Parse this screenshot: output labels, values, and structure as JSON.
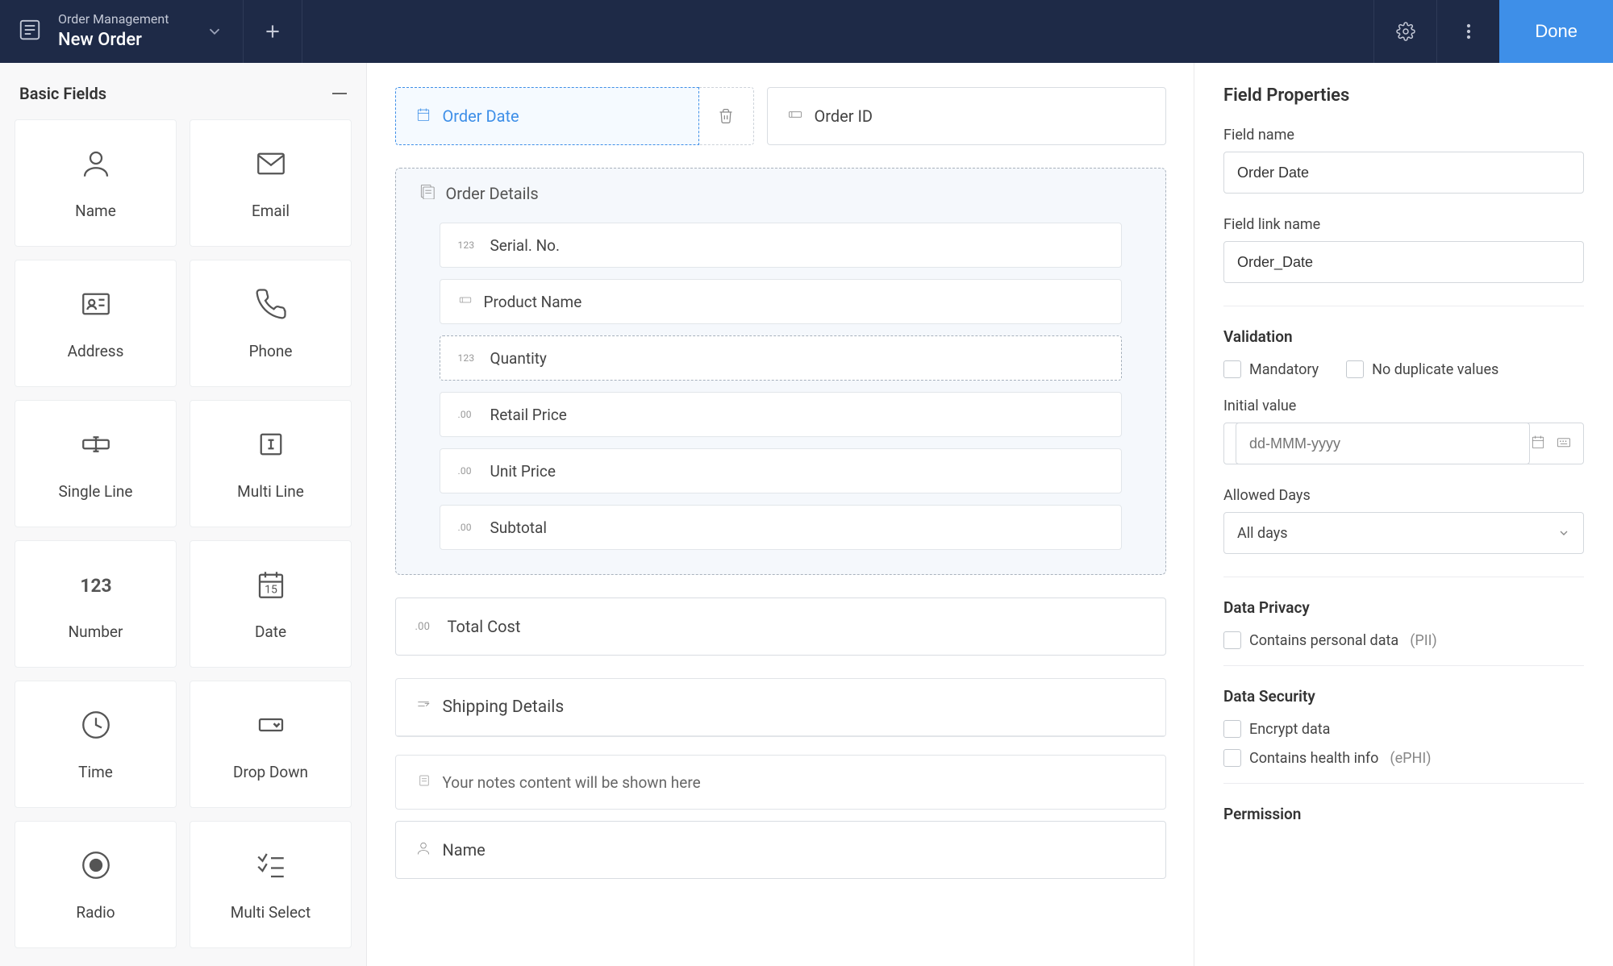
{
  "header": {
    "breadcrumb_top": "Order Management",
    "breadcrumb_bottom": "New Order",
    "done_label": "Done"
  },
  "sidebar": {
    "section_title": "Basic Fields",
    "fields": [
      {
        "label": "Name"
      },
      {
        "label": "Email"
      },
      {
        "label": "Address"
      },
      {
        "label": "Phone"
      },
      {
        "label": "Single Line"
      },
      {
        "label": "Multi Line"
      },
      {
        "label": "Number"
      },
      {
        "label": "Date"
      },
      {
        "label": "Time"
      },
      {
        "label": "Drop Down"
      },
      {
        "label": "Radio"
      },
      {
        "label": "Multi Select"
      }
    ]
  },
  "canvas": {
    "top_row": {
      "selected": {
        "label": "Order Date"
      },
      "right": {
        "label": "Order ID"
      }
    },
    "subform": {
      "title": "Order Details",
      "fields": [
        {
          "badge": "123",
          "label": "Serial. No."
        },
        {
          "badge_icon": "text",
          "label": "Product Name"
        },
        {
          "badge": "123",
          "label": "Quantity",
          "dashed": true
        },
        {
          "badge": ".00",
          "label": "Retail Price"
        },
        {
          "badge": ".00",
          "label": "Unit Price"
        },
        {
          "badge": ".00",
          "label": "Subtotal"
        }
      ]
    },
    "total": {
      "badge": ".00",
      "label": "Total Cost"
    },
    "section2": {
      "title": "Shipping Details"
    },
    "notes_placeholder": "Your notes content will be shown here",
    "name_field": {
      "label": "Name"
    }
  },
  "properties": {
    "title": "Field Properties",
    "field_name_label": "Field name",
    "field_name_value": "Order Date",
    "field_link_label": "Field link name",
    "field_link_value": "Order_Date",
    "validation_title": "Validation",
    "mandatory_label": "Mandatory",
    "noduplicate_label": "No duplicate values",
    "initial_value_label": "Initial value",
    "initial_value_placeholder": "dd-MMM-yyyy",
    "allowed_days_label": "Allowed Days",
    "allowed_days_value": "All days",
    "data_privacy_title": "Data Privacy",
    "pii_label": "Contains personal data",
    "pii_suffix": "(PII)",
    "data_security_title": "Data Security",
    "encrypt_label": "Encrypt data",
    "ephi_label": "Contains health info",
    "ephi_suffix": "(ePHI)",
    "permission_title": "Permission"
  }
}
